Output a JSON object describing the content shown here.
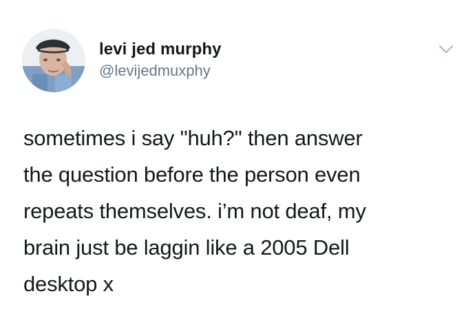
{
  "user": {
    "display_name": "levi jed murphy",
    "handle": "@levijedmuxphy",
    "avatar_icon": "profile-photo"
  },
  "tweet": {
    "lines": [
      "sometimes i say \"huh?\" then answer",
      "the question before the person even",
      "repeats themselves. i’m not deaf, my",
      "brain just be laggin like a 2005 Dell",
      "desktop x"
    ]
  },
  "menu": {
    "icon": "chevron-down-icon"
  },
  "colors": {
    "background": "#ffffff",
    "text": "#14171a",
    "secondary_text": "#657786",
    "chevron": "#aab8c2"
  }
}
